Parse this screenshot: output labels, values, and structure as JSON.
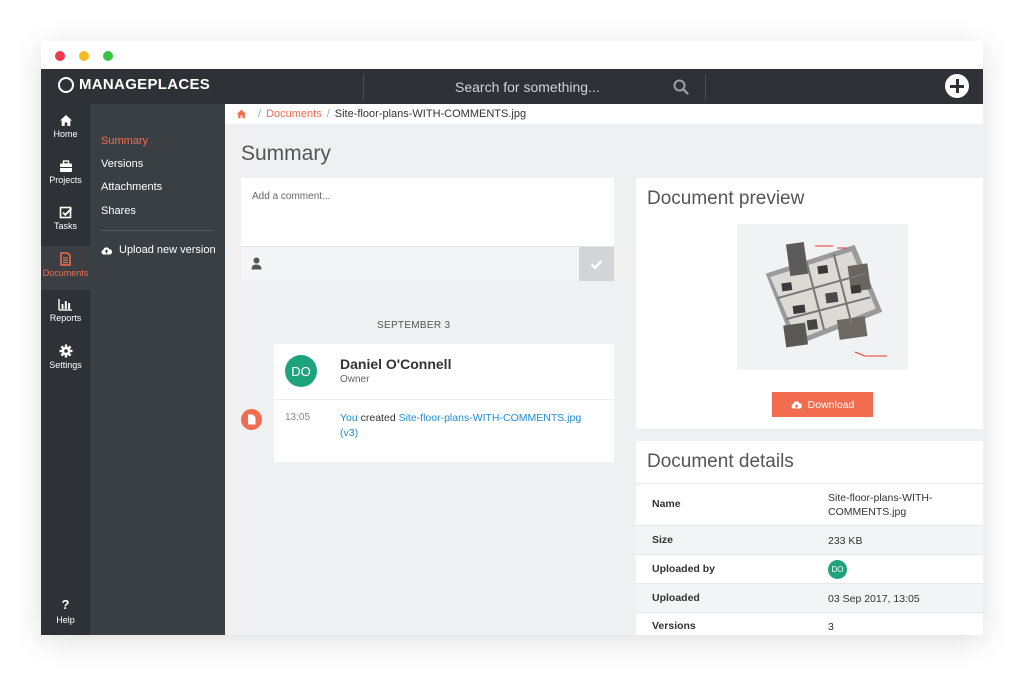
{
  "app": {
    "name": "MANAGEPLACES",
    "search_placeholder": "Search for something..."
  },
  "rail": {
    "items": [
      {
        "label": "Home",
        "icon": "home-icon"
      },
      {
        "label": "Projects",
        "icon": "briefcase-icon"
      },
      {
        "label": "Tasks",
        "icon": "checkbox-icon"
      },
      {
        "label": "Documents",
        "icon": "document-icon",
        "active": true
      },
      {
        "label": "Reports",
        "icon": "bar-chart-icon"
      },
      {
        "label": "Settings",
        "icon": "gear-icon"
      }
    ],
    "help_label": "Help",
    "help_icon_text": "?"
  },
  "subnav": {
    "items": [
      {
        "label": "Summary",
        "active": true
      },
      {
        "label": "Versions"
      },
      {
        "label": "Attachments"
      },
      {
        "label": "Shares"
      }
    ],
    "upload_label": "Upload new version"
  },
  "breadcrumb": {
    "separator": "/",
    "documents": "Documents",
    "current": "Site-floor-plans-WITH-COMMENTS.jpg"
  },
  "page_title": "Summary",
  "comment": {
    "placeholder": "Add a comment..."
  },
  "activity": {
    "date": "SEPTEMBER 3",
    "user_initials": "DO",
    "user_name": "Daniel O'Connell",
    "user_role": "Owner",
    "time": "13:05",
    "actor": "You",
    "action": " created ",
    "file_link": "Site-floor-plans-WITH-COMMENTS.jpg",
    "version": "(v3)"
  },
  "preview": {
    "title": "Document preview",
    "download_label": "Download"
  },
  "details": {
    "title": "Document details",
    "rows": [
      {
        "label": "Name",
        "value": "Site-floor-plans-WITH-COMMENTS.jpg"
      },
      {
        "label": "Size",
        "value": "233 KB"
      },
      {
        "label": "Uploaded by",
        "value": "DO"
      },
      {
        "label": "Uploaded",
        "value": "03 Sep 2017, 13:05"
      },
      {
        "label": "Versions",
        "value": "3"
      }
    ]
  },
  "colors": {
    "accent": "#f26c4f",
    "dark_nav": "#2e3236",
    "subnav": "#3a3f44",
    "avatar": "#1fa37d",
    "link_blue": "#1f8dd6"
  }
}
